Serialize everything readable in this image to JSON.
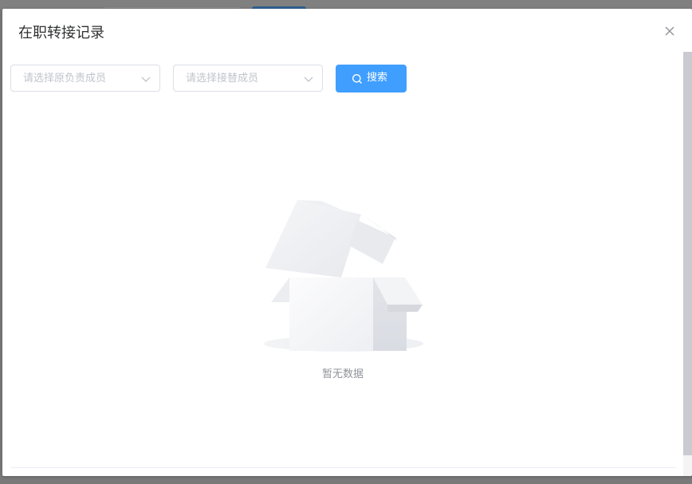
{
  "dialog": {
    "title": "在职转接记录"
  },
  "filters": {
    "original_owner_placeholder": "请选择原负责成员",
    "successor_placeholder": "请选择接替成员"
  },
  "search_button": {
    "label": "搜索",
    "icon": "search-icon"
  },
  "empty_state": {
    "text": "暂无数据",
    "icon": "empty-box-icon"
  },
  "colors": {
    "primary": "#409eff",
    "title_text": "#303133",
    "placeholder_text": "#c0c4cc",
    "empty_text": "#909399",
    "border": "#dcdfe6"
  }
}
